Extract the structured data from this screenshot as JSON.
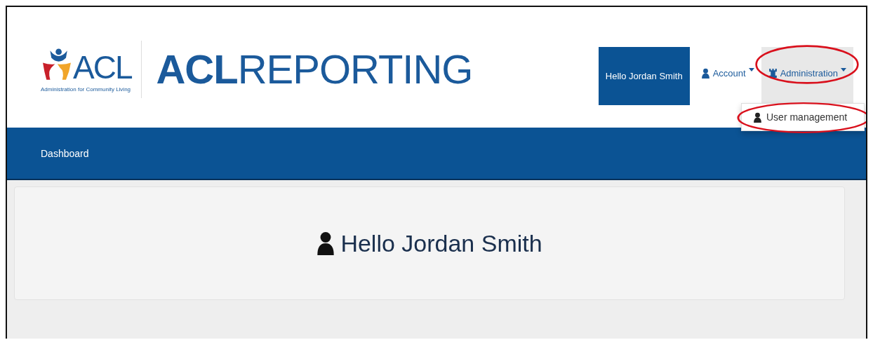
{
  "logo": {
    "mark": "ACL",
    "tagline": "Administration for Community Living"
  },
  "site_title": "**ACL**REPORTING",
  "greeting_button": "Hello Jordan Smith",
  "menus": [
    {
      "label": "Account",
      "kind": "account",
      "expanded": false,
      "highlighted": false
    },
    {
      "label": "Administration",
      "kind": "admin",
      "expanded": true,
      "highlighted": true,
      "items": [
        {
          "label": "User management",
          "highlighted": true
        }
      ]
    }
  ],
  "nav": [
    {
      "label": "Dashboard"
    }
  ],
  "welcome": "Hello Jordan Smith"
}
